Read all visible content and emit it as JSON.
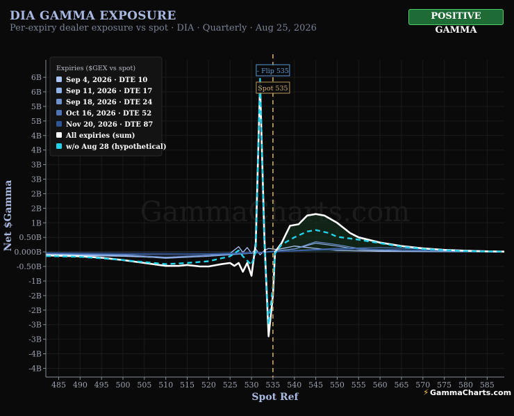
{
  "header": {
    "title": "DIA GAMMA EXPOSURE",
    "subtitle": "Per-expiry dealer exposure vs spot · DIA · Quarterly · Aug 25, 2026",
    "badge": "POSITIVE GAMMA"
  },
  "watermark": "GammaCharts.com",
  "brand": "GammaCharts.com",
  "colors": {
    "background": "#0a0a0a",
    "badge_fill": "#1e6b35",
    "badge_border": "#4fcf6b",
    "spot_line": "#b89a5e",
    "flip_label": "#5b9bd5"
  },
  "chart_data": {
    "type": "line",
    "xlabel": "Spot Ref",
    "ylabel": "Net $Gamma",
    "xlim": [
      482,
      589
    ],
    "ylim": [
      -4.3,
      6.6
    ],
    "x_ticks": [
      485,
      490,
      495,
      500,
      505,
      510,
      515,
      520,
      525,
      530,
      535,
      540,
      545,
      550,
      555,
      560,
      565,
      570,
      575,
      580,
      585
    ],
    "y_ticks": [
      {
        "v": 6.0,
        "label": "6B"
      },
      {
        "v": 5.5,
        "label": "6B"
      },
      {
        "v": 5.0,
        "label": "5B"
      },
      {
        "v": 4.5,
        "label": "5B"
      },
      {
        "v": 4.0,
        "label": "4B"
      },
      {
        "v": 3.5,
        "label": "4B"
      },
      {
        "v": 3.0,
        "label": "3B"
      },
      {
        "v": 2.5,
        "label": "3B"
      },
      {
        "v": 2.0,
        "label": "2B"
      },
      {
        "v": 1.5,
        "label": "2B"
      },
      {
        "v": 1.0,
        "label": "1B"
      },
      {
        "v": 0.5,
        "label": "0.50B"
      },
      {
        "v": 0.0,
        "label": "0.000B"
      },
      {
        "v": -0.5,
        "label": "-0.50B"
      },
      {
        "v": -1.0,
        "label": "-1B"
      },
      {
        "v": -1.5,
        "label": "-2B"
      },
      {
        "v": -2.0,
        "label": "-2B"
      },
      {
        "v": -2.5,
        "label": "-3B"
      },
      {
        "v": -3.0,
        "label": "-3B"
      },
      {
        "v": -3.5,
        "label": "-4B"
      },
      {
        "v": -4.0,
        "label": "-4B"
      }
    ],
    "grid": true,
    "legend_title": "Expiries ($GEX vs spot)",
    "legend_position": "top-left",
    "spot": {
      "x": 535,
      "label": "Spot 535"
    },
    "flip": {
      "x": 535,
      "label": "- Flip 535"
    },
    "series": [
      {
        "name": "Sep 4, 2026 · DTE 10",
        "color": "#aac4f5",
        "width": 1.3,
        "dash": "",
        "points": [
          [
            482,
            -0.1
          ],
          [
            500,
            -0.15
          ],
          [
            510,
            -0.2
          ],
          [
            520,
            -0.12
          ],
          [
            525,
            -0.05
          ],
          [
            527,
            0.18
          ],
          [
            528,
            -0.02
          ],
          [
            529,
            0.15
          ],
          [
            530,
            -0.05
          ],
          [
            531,
            0.1
          ],
          [
            532,
            -0.1
          ],
          [
            533,
            0.05
          ],
          [
            534,
            0.12
          ],
          [
            536,
            0.08
          ],
          [
            540,
            0.2
          ],
          [
            545,
            0.12
          ],
          [
            550,
            0.05
          ],
          [
            560,
            0.02
          ],
          [
            589,
            0.0
          ]
        ]
      },
      {
        "name": "Sep 11, 2026 · DTE 17",
        "color": "#8fb2e8",
        "width": 1.2,
        "dash": "",
        "points": [
          [
            482,
            -0.08
          ],
          [
            500,
            -0.12
          ],
          [
            510,
            -0.22
          ],
          [
            520,
            -0.15
          ],
          [
            530,
            -0.05
          ],
          [
            535,
            0.02
          ],
          [
            540,
            0.1
          ],
          [
            545,
            0.3
          ],
          [
            550,
            0.2
          ],
          [
            555,
            0.08
          ],
          [
            565,
            0.02
          ],
          [
            589,
            0.0
          ]
        ]
      },
      {
        "name": "Sep 18, 2026 · DTE 24",
        "color": "#6f92cf",
        "width": 1.2,
        "dash": "",
        "points": [
          [
            482,
            -0.06
          ],
          [
            500,
            -0.1
          ],
          [
            510,
            -0.18
          ],
          [
            520,
            -0.12
          ],
          [
            530,
            -0.05
          ],
          [
            540,
            0.1
          ],
          [
            545,
            0.35
          ],
          [
            550,
            0.25
          ],
          [
            555,
            0.12
          ],
          [
            565,
            0.04
          ],
          [
            589,
            0.0
          ]
        ]
      },
      {
        "name": "Oct 16, 2026 · DTE 52",
        "color": "#4f73b5",
        "width": 1.2,
        "dash": "",
        "points": [
          [
            482,
            -0.05
          ],
          [
            500,
            -0.08
          ],
          [
            515,
            -0.1
          ],
          [
            530,
            -0.05
          ],
          [
            540,
            0.05
          ],
          [
            550,
            0.12
          ],
          [
            560,
            0.15
          ],
          [
            570,
            0.1
          ],
          [
            589,
            0.02
          ]
        ]
      },
      {
        "name": "Nov 20, 2026 · DTE 87",
        "color": "#2f5597",
        "width": 1.2,
        "dash": "",
        "points": [
          [
            482,
            -0.03
          ],
          [
            500,
            -0.05
          ],
          [
            520,
            -0.06
          ],
          [
            535,
            0.0
          ],
          [
            545,
            0.06
          ],
          [
            555,
            0.1
          ],
          [
            565,
            0.08
          ],
          [
            575,
            0.05
          ],
          [
            589,
            0.02
          ]
        ]
      },
      {
        "name": "All expiries (sum)",
        "color": "#ffffff",
        "width": 2.6,
        "dash": "",
        "points": [
          [
            482,
            -0.12
          ],
          [
            490,
            -0.15
          ],
          [
            495,
            -0.2
          ],
          [
            500,
            -0.28
          ],
          [
            505,
            -0.38
          ],
          [
            510,
            -0.48
          ],
          [
            513,
            -0.48
          ],
          [
            515,
            -0.45
          ],
          [
            518,
            -0.5
          ],
          [
            520,
            -0.5
          ],
          [
            523,
            -0.42
          ],
          [
            525,
            -0.38
          ],
          [
            526,
            -0.48
          ],
          [
            527,
            -0.38
          ],
          [
            528,
            -0.68
          ],
          [
            529,
            -0.38
          ],
          [
            530,
            -0.82
          ],
          [
            531,
            0.3
          ],
          [
            532,
            5.8
          ],
          [
            533,
            0.5
          ],
          [
            534,
            -2.9
          ],
          [
            535,
            -1.5
          ],
          [
            535.5,
            0.0
          ],
          [
            537,
            0.3
          ],
          [
            538,
            0.6
          ],
          [
            539,
            0.9
          ],
          [
            541,
            0.95
          ],
          [
            543,
            1.25
          ],
          [
            545,
            1.3
          ],
          [
            547,
            1.25
          ],
          [
            550,
            1.0
          ],
          [
            553,
            0.65
          ],
          [
            555,
            0.5
          ],
          [
            560,
            0.32
          ],
          [
            565,
            0.2
          ],
          [
            570,
            0.12
          ],
          [
            575,
            0.07
          ],
          [
            580,
            0.04
          ],
          [
            585,
            0.02
          ],
          [
            589,
            0.01
          ]
        ]
      },
      {
        "name": "w/o Aug 28 (hypothetical)",
        "color": "#22d3ee",
        "width": 2.4,
        "dash": "7,5",
        "points": [
          [
            482,
            -0.14
          ],
          [
            490,
            -0.17
          ],
          [
            495,
            -0.22
          ],
          [
            500,
            -0.28
          ],
          [
            505,
            -0.35
          ],
          [
            510,
            -0.42
          ],
          [
            515,
            -0.38
          ],
          [
            520,
            -0.32
          ],
          [
            525,
            -0.15
          ],
          [
            527,
            0.05
          ],
          [
            528,
            -0.15
          ],
          [
            530,
            -0.45
          ],
          [
            531,
            0.0
          ],
          [
            532,
            5.95
          ],
          [
            533,
            0.3
          ],
          [
            534,
            -2.5
          ],
          [
            535,
            -1.2
          ],
          [
            535.5,
            -0.05
          ],
          [
            537,
            0.25
          ],
          [
            540,
            0.5
          ],
          [
            543,
            0.7
          ],
          [
            545,
            0.75
          ],
          [
            548,
            0.65
          ],
          [
            550,
            0.52
          ],
          [
            555,
            0.42
          ],
          [
            560,
            0.3
          ],
          [
            565,
            0.18
          ],
          [
            570,
            0.1
          ],
          [
            575,
            0.06
          ],
          [
            580,
            0.03
          ],
          [
            589,
            0.01
          ]
        ]
      }
    ]
  }
}
